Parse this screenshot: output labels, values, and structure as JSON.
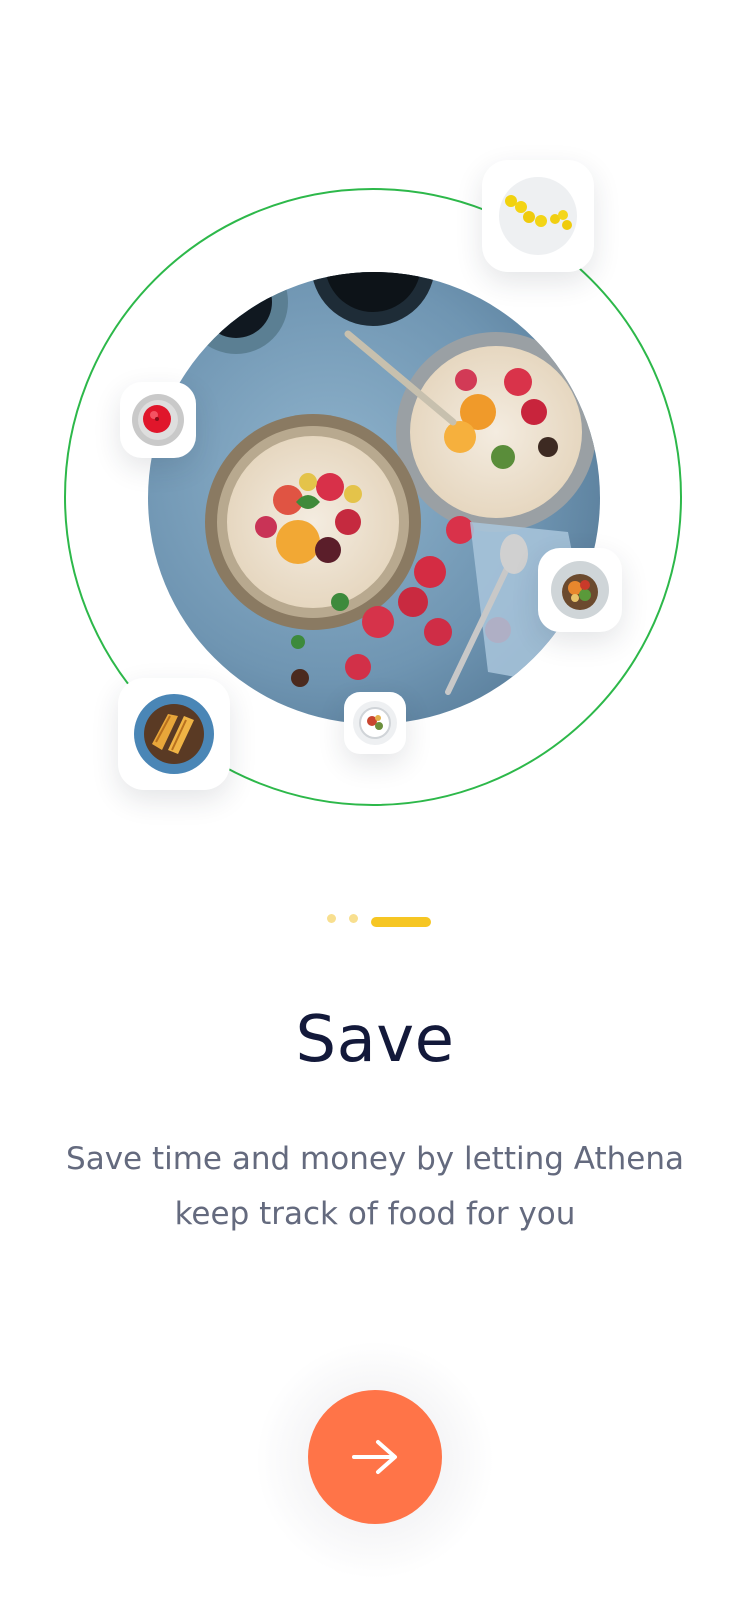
{
  "onboarding": {
    "title": "Save",
    "description": "Save time and money by letting Athena keep track of food for you",
    "pagination": {
      "total": 3,
      "current": 3
    }
  },
  "next_button": {
    "icon": "arrow-right-icon"
  },
  "images": {
    "hero": "breakfast-bowls-photo",
    "thumbnails": [
      "lemons-photo",
      "apple-photo",
      "salad-bowl-photo",
      "grilled-sandwich-photo",
      "plated-dish-photo"
    ]
  },
  "colors": {
    "accent": "#ff7448",
    "ring": "#2db84a",
    "indicator_active": "#f6c623",
    "indicator_inactive": "#f8df8f",
    "title": "#13193a",
    "body_text": "#646a7e"
  }
}
